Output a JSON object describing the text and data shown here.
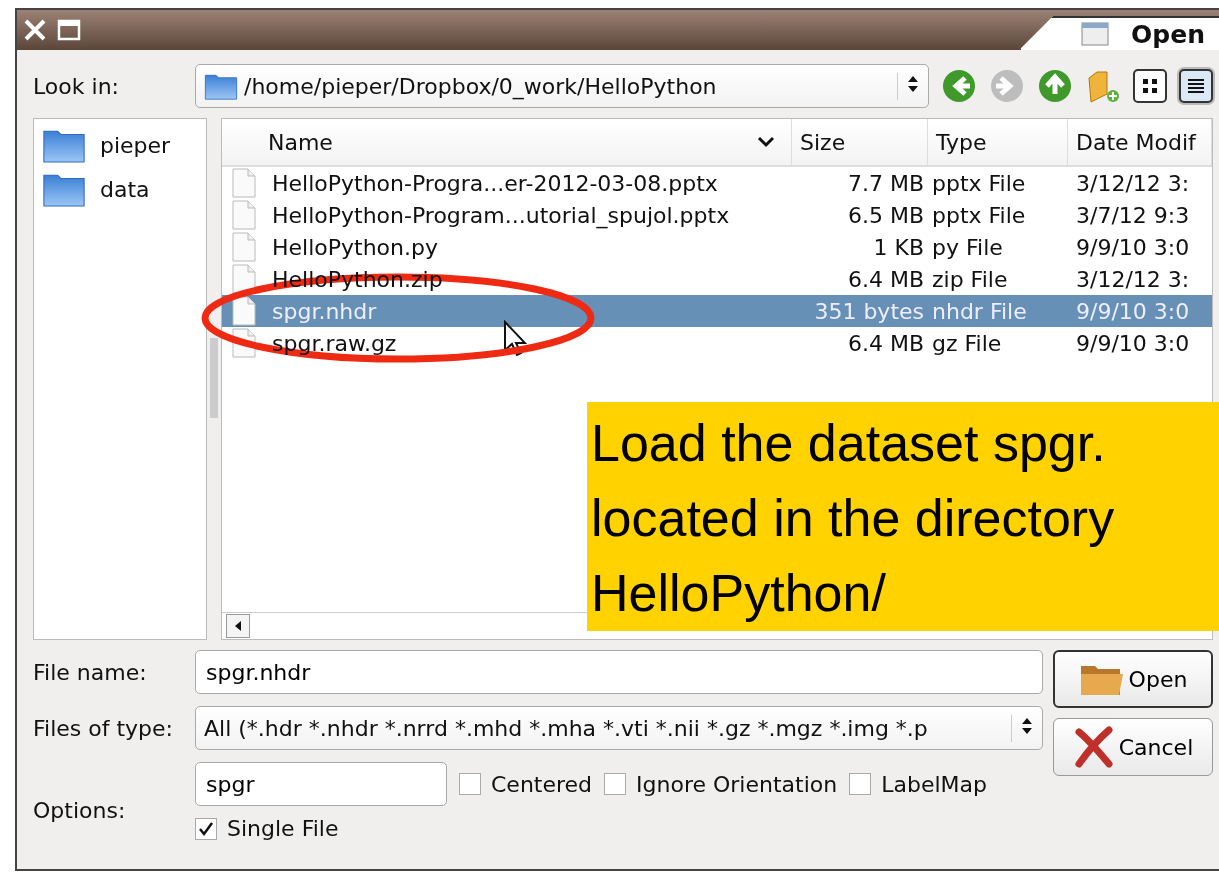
{
  "window": {
    "title": "Open"
  },
  "look_in": {
    "label": "Look in:",
    "path": "/home/pieper/Dropbox/0_work/HelloPython"
  },
  "nav": [
    {
      "kind": "back",
      "disabled": false
    },
    {
      "kind": "forward",
      "disabled": true
    },
    {
      "kind": "up",
      "disabled": false
    },
    {
      "kind": "new-folder"
    }
  ],
  "view_modes": [
    {
      "kind": "icons",
      "selected": false
    },
    {
      "kind": "details",
      "selected": true
    }
  ],
  "places": [
    {
      "label": "pieper"
    },
    {
      "label": "data"
    }
  ],
  "files": {
    "columns": [
      "Name",
      "Size",
      "Type",
      "Date Modif"
    ],
    "rows": [
      {
        "name": "HelloPython-Progra...er-2012-03-08.pptx",
        "size": "7.7 MB",
        "type": "pptx File",
        "date": "3/12/12 3:",
        "selected": false
      },
      {
        "name": "HelloPython-Program...utorial_spujol.pptx",
        "size": "6.5 MB",
        "type": "pptx File",
        "date": "3/7/12 9:3",
        "selected": false
      },
      {
        "name": "HelloPython.py",
        "size": "1 KB",
        "type": "py File",
        "date": "9/9/10 3:0",
        "selected": false
      },
      {
        "name": "HelloPython.zip",
        "size": "6.4 MB",
        "type": "zip File",
        "date": "3/12/12 3:",
        "selected": false
      },
      {
        "name": "spgr.nhdr",
        "size": "351 bytes",
        "type": "nhdr File",
        "date": "9/9/10 3:0",
        "selected": true
      },
      {
        "name": "spgr.raw.gz",
        "size": "6.4 MB",
        "type": "gz File",
        "date": "9/9/10 3:0",
        "selected": false
      }
    ]
  },
  "file_name": {
    "label": "File name:",
    "value": "spgr.nhdr"
  },
  "file_type": {
    "label": "Files of type:",
    "value": "All (*.hdr *.nhdr *.nrrd *.mhd *.mha *.vti *.nii *.gz *.mgz *.img *.p"
  },
  "options": {
    "label": "Options:",
    "value": "spgr",
    "checkboxes": [
      {
        "label": "Centered",
        "checked": false
      },
      {
        "label": "Ignore Orientation",
        "checked": false
      },
      {
        "label": "LabelMap",
        "checked": false
      },
      {
        "label": "Single File",
        "checked": true
      }
    ]
  },
  "buttons": [
    {
      "kind": "open",
      "label": "Open"
    },
    {
      "kind": "cancel",
      "label": "Cancel"
    }
  ],
  "callout": {
    "lines": [
      "Load the dataset spgr.",
      "located in the directory",
      "HelloPython/"
    ]
  }
}
